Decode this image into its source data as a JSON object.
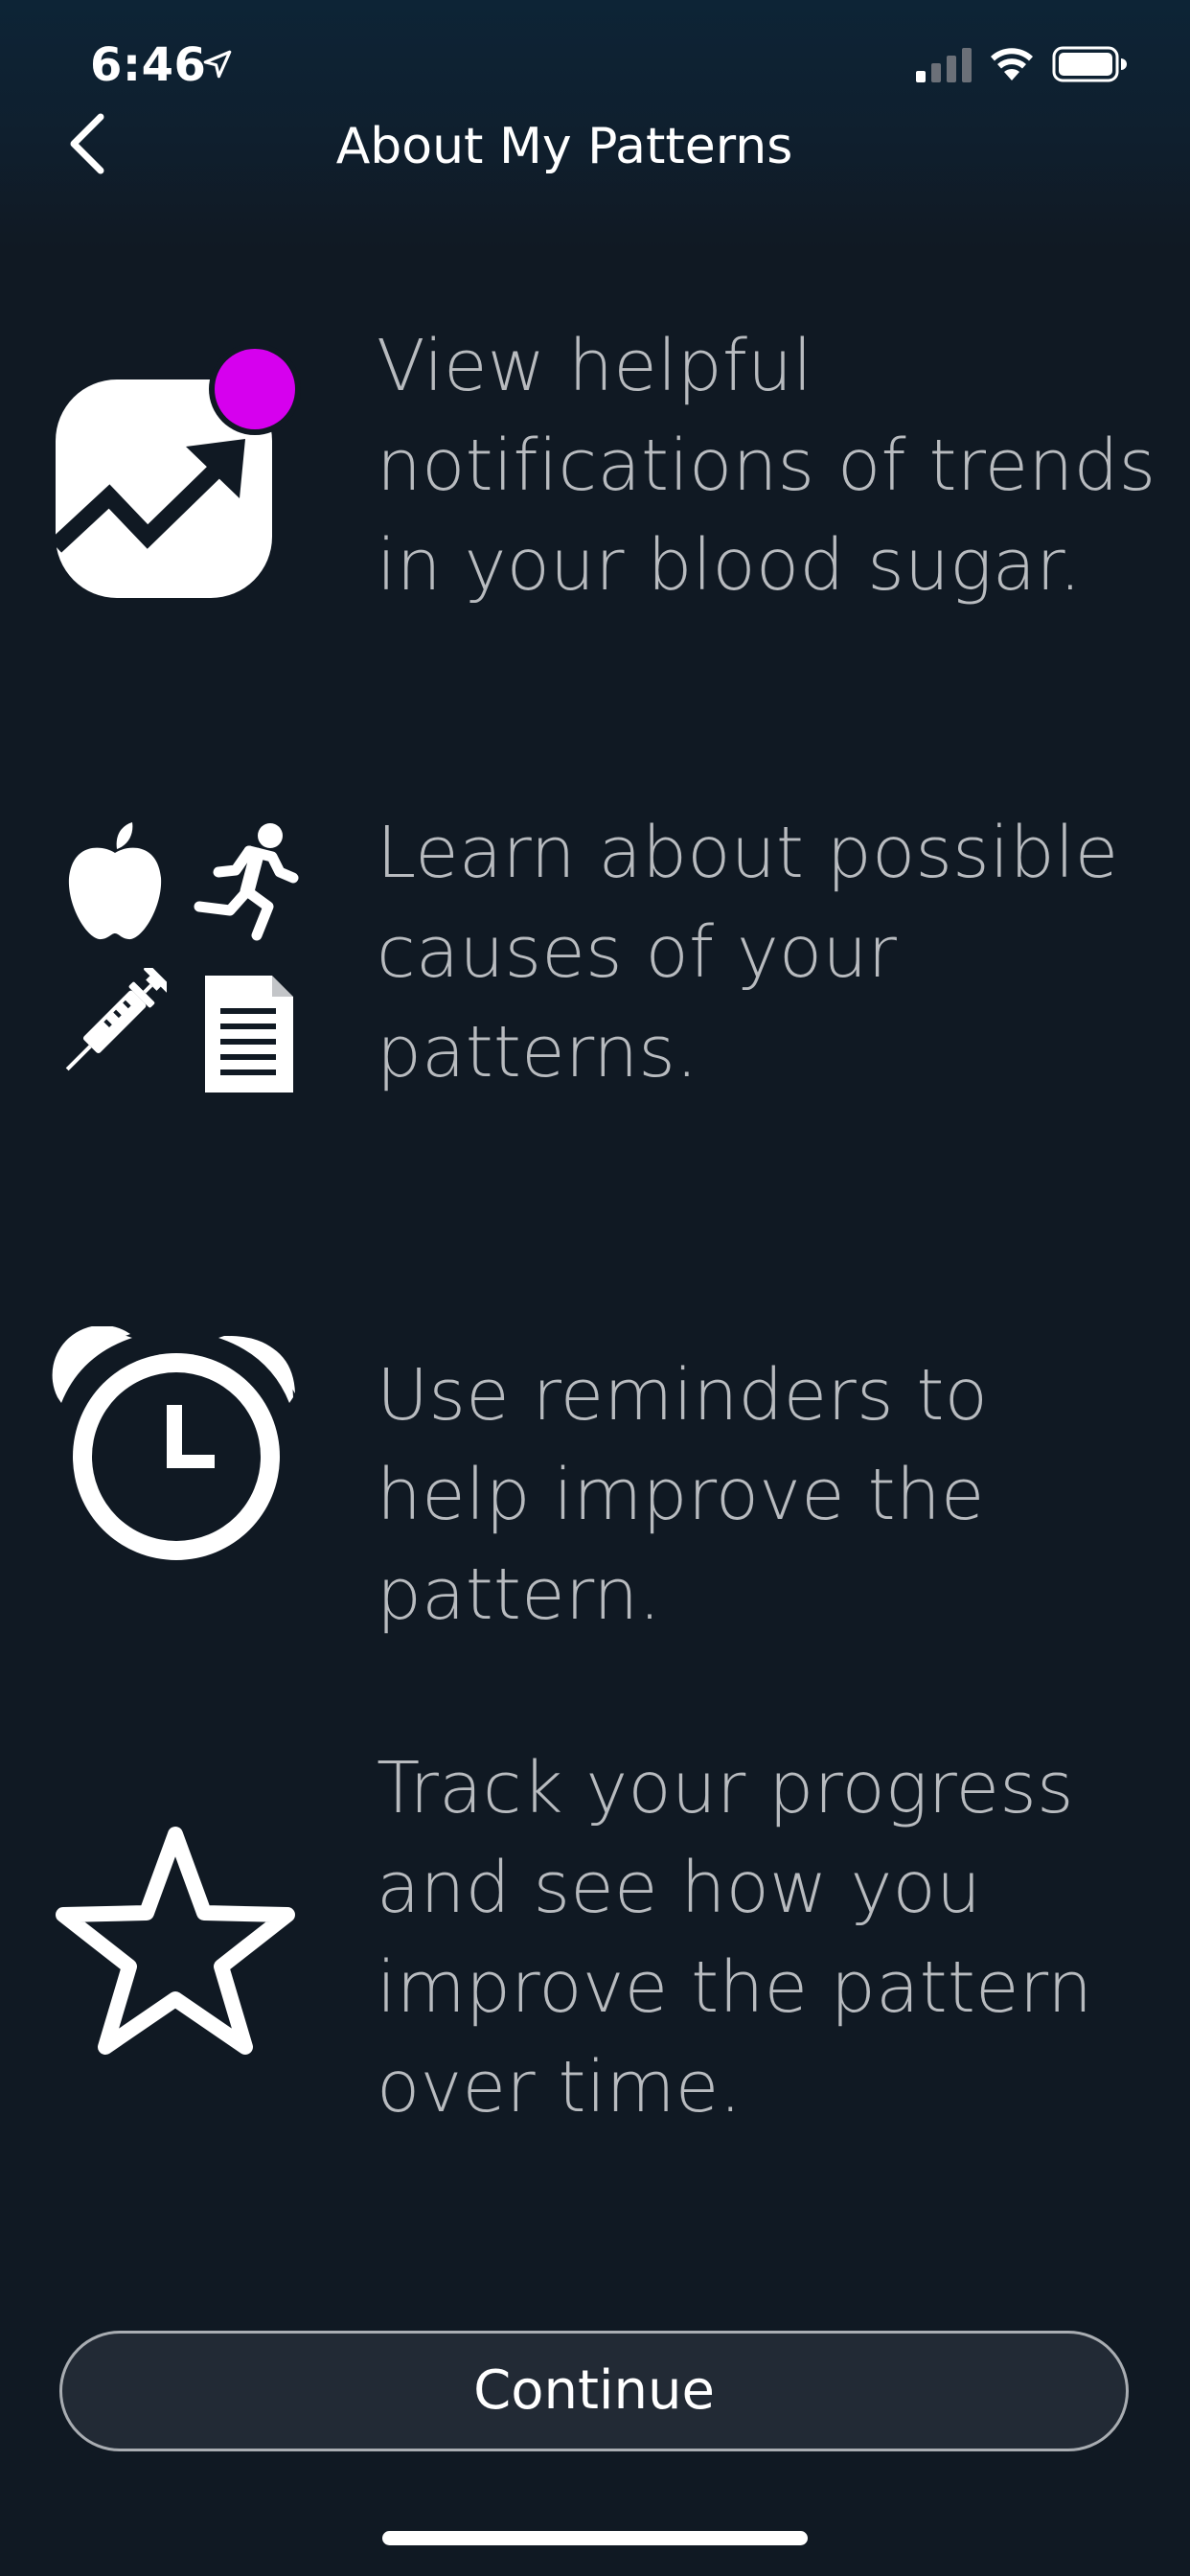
{
  "status_bar": {
    "time": "6:46",
    "location_icon": "location-arrow-icon",
    "signal_icon": "cellular-signal-icon",
    "wifi_icon": "wifi-icon",
    "battery_icon": "battery-icon"
  },
  "nav": {
    "back_icon": "chevron-left-icon",
    "title": "About My Patterns"
  },
  "features": [
    {
      "icon": "trend-notification-icon",
      "text": "View helpful notifications of trends in your blood sugar."
    },
    {
      "icon": "causes-icon-group",
      "text": "Learn about possible causes of your patterns."
    },
    {
      "icon": "alarm-clock-icon",
      "text": "Use reminders to help improve the pattern."
    },
    {
      "icon": "star-icon",
      "text": "Track your progress and see how you improve the pattern over time."
    }
  ],
  "continue_label": "Continue",
  "colors": {
    "background": "#101923",
    "notification_dot": "#d600ee",
    "body_text": "#b8bbbf",
    "icon": "#ffffff"
  }
}
